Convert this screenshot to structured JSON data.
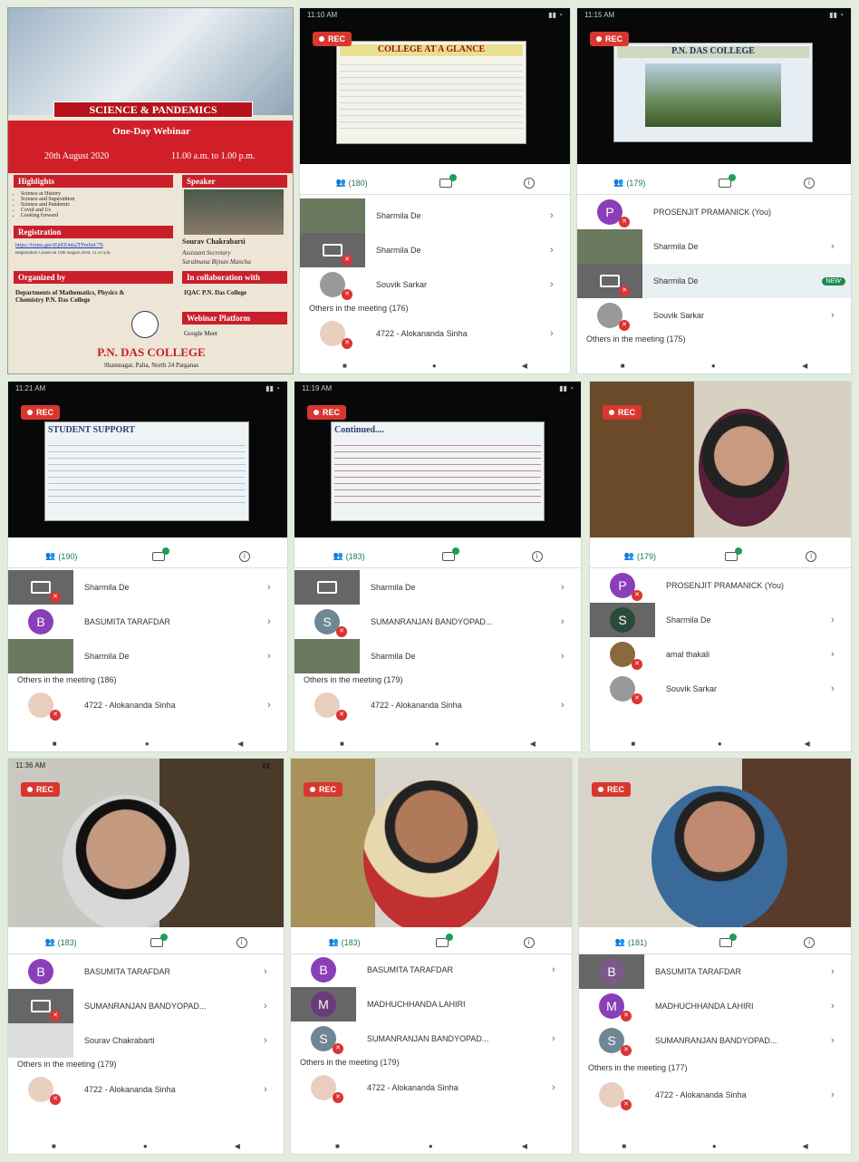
{
  "poster": {
    "title": "SCIENCE & PANDEMICS",
    "subtitle": "One-Day Webinar",
    "date": "20th August 2020",
    "time": "11.00 a.m. to 1.00 p.m.",
    "highlights_label": "Highlights",
    "highlights": [
      "Science at History",
      "Science and Superstition",
      "Science and Pandemic",
      "Covid and Us",
      "Looking forward"
    ],
    "speaker_label": "Speaker",
    "speaker_name": "Sourav Chakrabarti",
    "speaker_role": "Assistant Secretary",
    "speaker_org": "Saralmana Bijnan Mancha",
    "registration_label": "Registration",
    "registration_link": "https://forms.gle/iEjrEE4ds2TPmSnC76",
    "registration_note": "Registration Closes on 19th August 2020, 11.59 a.m.",
    "organized_label": "Organized by",
    "organized_by": "Departments of Mathematics, Physics & Chemistry P.N. Das College",
    "collab_label": "In collaboration with",
    "collab": "IQAC P.N. Das College",
    "platform_label": "Webinar Platform",
    "platform": "Google Meet",
    "college": "P.N. DAS COLLEGE",
    "address": "Shamnagar, Palta, North 24 Parganas"
  },
  "rec_label": "REC",
  "panels": [
    {
      "time": "11:10 AM",
      "participants": "(180)",
      "slide_title": "COLLEGE AT A GLANCE",
      "rows": [
        "Sharmila De",
        "Sharmila De",
        "Souvik Sarkar"
      ],
      "others": "Others in the meeting (176)",
      "other_first": "4722 - Alokananda Sinha"
    },
    {
      "time": "11:15 AM",
      "participants": "(179)",
      "slide_title": "P.N. DAS COLLEGE",
      "rows": [
        "PROSENJIT PRAMANICK (You)",
        "Sharmila De",
        "Sharmila De",
        "Souvik Sarkar"
      ],
      "new_badge": "NEW",
      "others": "Others in the meeting (175)"
    },
    {
      "time": "11:21 AM",
      "participants": "(190)",
      "slide_title": "STUDENT SUPPORT",
      "rows": [
        "Sharmila De",
        "BASUMITA TARAFDAR",
        "Sharmila De"
      ],
      "others": "Others in the meeting (186)",
      "other_first": "4722 - Alokananda Sinha"
    },
    {
      "time": "11:19 AM",
      "participants": "(183)",
      "slide_title": "Continued....",
      "rows": [
        "Sharmila De",
        "SUMANRANJAN BANDYOPAD...",
        "Sharmila De"
      ],
      "others": "Others in the meeting (179)",
      "other_first": "4722 - Alokananda Sinha"
    },
    {
      "participants": "(179)",
      "rows": [
        "PROSENJIT PRAMANICK (You)",
        "Sharmila De",
        "amal thakali",
        "Souvik Sarkar"
      ]
    },
    {
      "time": "11:36 AM",
      "participants": "(183)",
      "rows": [
        "BASUMITA TARAFDAR",
        "SUMANRANJAN BANDYOPAD...",
        "Sourav Chakrabarti"
      ],
      "others": "Others in the meeting (179)",
      "other_first": "4722 - Alokananda Sinha"
    },
    {
      "participants": "(183)",
      "rows": [
        "BASUMITA TARAFDAR",
        "MADHUCHHANDA LAHIRI",
        "SUMANRANJAN BANDYOPAD..."
      ],
      "others": "Others in the meeting (179)",
      "other_first": "4722 - Alokananda Sinha"
    },
    {
      "participants": "(181)",
      "rows": [
        "BASUMITA TARAFDAR",
        "MADHUCHHANDA LAHIRI",
        "SUMANRANJAN BANDYOPAD..."
      ],
      "others": "Others in the meeting (177)",
      "other_first": "4722 - Alokananda Sinha"
    }
  ],
  "colors": {
    "rec": "#d8372f",
    "accent": "#1e7a52",
    "avatar_purple": "#8a3fb8",
    "avatar_grey": "#6f8794",
    "poster_red": "#c81f2b"
  }
}
